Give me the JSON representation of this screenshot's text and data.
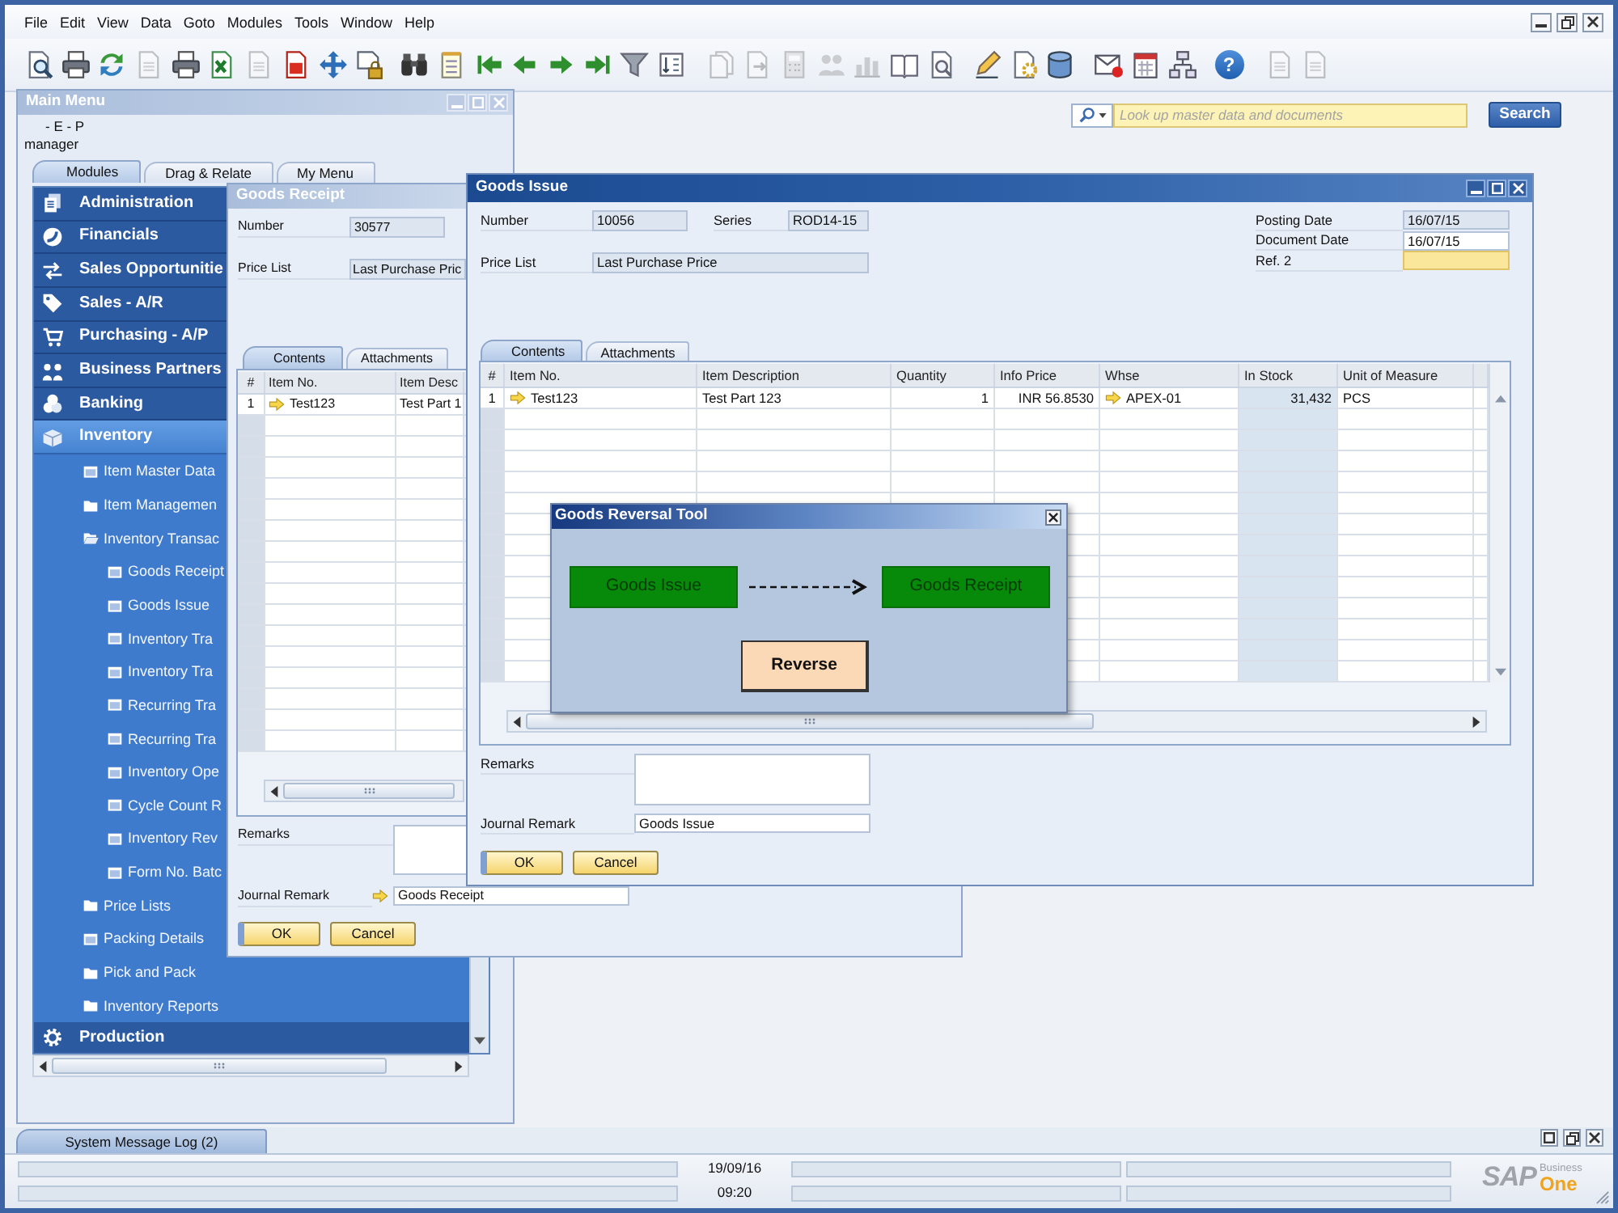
{
  "menu_bar": {
    "items": [
      "File",
      "Edit",
      "View",
      "Data",
      "Goto",
      "Modules",
      "Tools",
      "Window",
      "Help"
    ]
  },
  "toolbar": {
    "buttons": [
      {
        "disabled": false
      },
      {
        "disabled": false
      },
      {
        "disabled": false
      },
      {
        "disabled": true
      },
      {
        "disabled": false
      },
      {
        "disabled": false
      },
      {
        "disabled": true
      },
      {
        "disabled": false
      },
      {
        "disabled": false
      },
      {
        "disabled": false
      },
      {
        "disabled": false
      },
      {
        "disabled": false
      },
      {
        "disabled": false
      },
      {
        "disabled": false
      },
      {
        "disabled": false
      },
      {
        "disabled": false
      },
      {
        "disabled": false
      },
      {
        "disabled": false
      },
      {
        "disabled": true
      },
      {
        "disabled": true
      },
      {
        "disabled": true
      },
      {
        "disabled": true
      },
      {
        "disabled": true
      },
      {
        "disabled": false
      },
      {
        "disabled": false
      },
      {
        "disabled": false
      },
      {
        "disabled": false
      },
      {
        "disabled": false
      },
      {
        "disabled": false
      },
      {
        "disabled": false
      },
      {
        "disabled": false
      },
      {
        "disabled": false,
        "glyph": "?"
      },
      {
        "disabled": true
      },
      {
        "disabled": true
      }
    ]
  },
  "search": {
    "placeholder": "Look up master data and documents",
    "button": "Search"
  },
  "main_menu": {
    "title": "Main Menu",
    "active": false,
    "company": "- E - P",
    "user": "manager",
    "tabs": [
      {
        "label": "Modules",
        "selected": true
      },
      {
        "label": "Drag & Relate",
        "selected": false
      },
      {
        "label": "My Menu",
        "selected": false
      }
    ],
    "modules": [
      {
        "label": "Administration",
        "expanded": false
      },
      {
        "label": "Financials",
        "expanded": false
      },
      {
        "label": "Sales Opportunitie",
        "expanded": false
      },
      {
        "label": "Sales - A/R",
        "expanded": false
      },
      {
        "label": "Purchasing - A/P",
        "expanded": false
      },
      {
        "label": "Business Partners",
        "expanded": false
      },
      {
        "label": "Banking",
        "expanded": false
      },
      {
        "label": "Inventory",
        "expanded": true,
        "children": [
          {
            "label": "Item Master Data",
            "kind": "form"
          },
          {
            "label": "Item Managemen",
            "kind": "folder",
            "expanded": false
          },
          {
            "label": "Inventory Transac",
            "kind": "folder",
            "expanded": true,
            "children": [
              {
                "label": "Goods Receipt",
                "kind": "form"
              },
              {
                "label": "Goods Issue",
                "kind": "form"
              },
              {
                "label": "Inventory Tra",
                "kind": "form"
              },
              {
                "label": "Inventory Tra",
                "kind": "form"
              },
              {
                "label": "Recurring Tra",
                "kind": "form"
              },
              {
                "label": "Recurring Tra",
                "kind": "form"
              },
              {
                "label": "Inventory Ope",
                "kind": "form"
              },
              {
                "label": "Cycle Count R",
                "kind": "form"
              },
              {
                "label": "Inventory Rev",
                "kind": "form"
              },
              {
                "label": "Form No. Batc",
                "kind": "form"
              }
            ]
          },
          {
            "label": "Price Lists",
            "kind": "folder",
            "expanded": false
          },
          {
            "label": "Packing Details",
            "kind": "form"
          },
          {
            "label": "Pick and Pack",
            "kind": "folder",
            "expanded": false
          },
          {
            "label": "Inventory Reports",
            "kind": "folder",
            "expanded": false
          }
        ]
      },
      {
        "label": "Production",
        "expanded": false
      }
    ]
  },
  "goods_receipt": {
    "title": "Goods Receipt",
    "active": false,
    "fields": [
      {
        "label": "Number",
        "value": "30577",
        "editable": false,
        "focused": false
      },
      {
        "label": "Price List",
        "value": "Last Purchase Pric",
        "editable": false,
        "focused": false
      }
    ],
    "tabs": [
      {
        "label": "Contents",
        "selected": true
      },
      {
        "label": "Attachments",
        "selected": false
      }
    ],
    "table": {
      "columns": [
        {
          "label": "#",
          "kind": "index"
        },
        {
          "label": "Item No.",
          "kind": "link"
        },
        {
          "label": "Item Desc",
          "kind": "text"
        }
      ],
      "rows": [
        {
          "cells": [
            "1",
            "Test123",
            "Test Part 1"
          ]
        }
      ]
    },
    "remarks": {
      "label": "Remarks"
    },
    "journal_remark": {
      "label": "Journal Remark",
      "value": "Goods Receipt",
      "link": true
    },
    "buttons": [
      "OK",
      "Cancel"
    ]
  },
  "goods_issue": {
    "title": "Goods Issue",
    "active": true,
    "fields_left": [
      {
        "label": "Number",
        "value": "10056",
        "editable": false,
        "focused": false
      },
      {
        "label": "Series",
        "value": "ROD14-15",
        "editable": false,
        "focused": false
      },
      {
        "label": "Price List",
        "value": "Last Purchase Price",
        "editable": false,
        "focused": false
      }
    ],
    "fields_right": [
      {
        "label": "Posting Date",
        "value": "16/07/15",
        "editable": false,
        "focused": false
      },
      {
        "label": "Document Date",
        "value": "16/07/15",
        "editable": true,
        "focused": false
      },
      {
        "label": "Ref. 2",
        "editable": true,
        "focused": true
      }
    ],
    "tabs": [
      {
        "label": "Contents",
        "selected": true
      },
      {
        "label": "Attachments",
        "selected": false
      }
    ],
    "table": {
      "columns": [
        {
          "label": "#",
          "kind": "index"
        },
        {
          "label": "Item No.",
          "kind": "link"
        },
        {
          "label": "Item Description",
          "kind": "text"
        },
        {
          "label": "Quantity",
          "kind": "number"
        },
        {
          "label": "Info Price",
          "kind": "number"
        },
        {
          "label": "Whse",
          "kind": "link"
        },
        {
          "label": "In Stock",
          "kind": "stock"
        },
        {
          "label": "Unit of Measure",
          "kind": "text"
        }
      ],
      "rows": [
        {
          "cells": [
            "1",
            "Test123",
            "Test Part 123",
            "1",
            "INR 56.8530",
            "APEX-01",
            "31,432",
            "PCS"
          ]
        }
      ]
    },
    "remarks": {
      "label": "Remarks"
    },
    "journal_remark": {
      "label": "Journal Remark",
      "value": "Goods Issue",
      "link": false
    },
    "buttons": [
      "OK",
      "Cancel"
    ]
  },
  "reversal_dialog": {
    "title": "Goods Reversal Tool",
    "source": "Goods Issue",
    "target": "Goods Receipt",
    "button": "Reverse"
  },
  "message_log": {
    "tab": "System Message Log (2)"
  },
  "status_bar": {
    "date": "19/09/16",
    "time": "09:20",
    "logo": {
      "brand": "SAP",
      "line_1": "Business",
      "line_2": "One"
    }
  }
}
